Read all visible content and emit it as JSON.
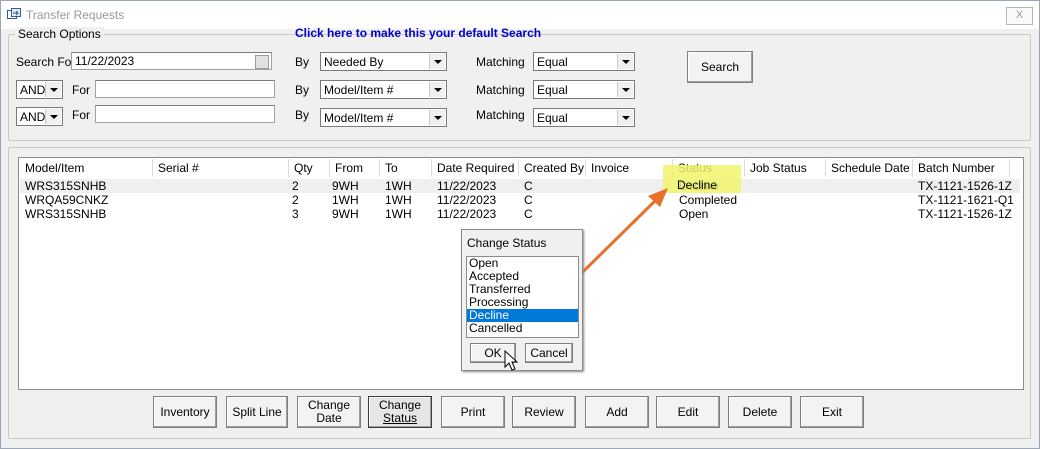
{
  "window": {
    "title": "Transfer Requests",
    "close_label": "X"
  },
  "search_options": {
    "legend": "Search Options",
    "default_link": "Click here to make this your default Search",
    "row1": {
      "label": "Search For",
      "value": "11/22/2023",
      "by_label": "By",
      "by_value": "Needed By",
      "matching_label": "Matching",
      "matching_value": "Equal"
    },
    "row2": {
      "conj": "AND",
      "for_label": "For",
      "value": "",
      "by_label": "By",
      "by_value": "Model/Item #",
      "matching_label": "Matching",
      "matching_value": "Equal"
    },
    "row3": {
      "conj": "AND",
      "for_label": "For",
      "value": "",
      "by_label": "By",
      "by_value": "Model/Item #",
      "matching_label": "Matching",
      "matching_value": "Equal"
    },
    "search_button": "Search"
  },
  "table": {
    "columns": [
      "Model/Item",
      "Serial #",
      "Qty",
      "From",
      "To",
      "Date Required",
      "Created By",
      "Invoice",
      "Status",
      "Job Status",
      "Schedule Date",
      "Batch Number"
    ],
    "rows": [
      [
        "WRS315SNHB",
        "",
        "2",
        "9WH",
        "1WH",
        "11/22/2023",
        "C",
        "",
        "Decline",
        "",
        "",
        "TX-1121-1526-1Z"
      ],
      [
        "WRQA59CNKZ",
        "",
        "2",
        "1WH",
        "1WH",
        "11/22/2023",
        "C",
        "",
        "Completed",
        "",
        "",
        "TX-1121-1621-Q1"
      ],
      [
        "WRS315SNHB",
        "",
        "3",
        "9WH",
        "1WH",
        "11/22/2023",
        "C",
        "",
        "Open",
        "",
        "",
        "TX-1121-1526-1Z"
      ]
    ]
  },
  "dialog": {
    "title": "Change Status",
    "options": [
      "Open",
      "Accepted",
      "Transferred",
      "Processing",
      "Decline",
      "Cancelled"
    ],
    "selected": "Decline",
    "ok": "OK",
    "cancel": "Cancel"
  },
  "buttons": {
    "inventory": "Inventory",
    "split_line": "Split Line",
    "change_date_1": "Change",
    "change_date_2": "Date",
    "change_status_1": "Change",
    "change_status_2": "Status",
    "print": "Print",
    "review": "Review",
    "add": "Add",
    "edit": "Edit",
    "delete": "Delete",
    "exit": "Exit"
  },
  "colors": {
    "highlight": "#f1f56a",
    "arrow": "#e8702a",
    "selection": "#0078d7",
    "link": "#0000cc"
  }
}
